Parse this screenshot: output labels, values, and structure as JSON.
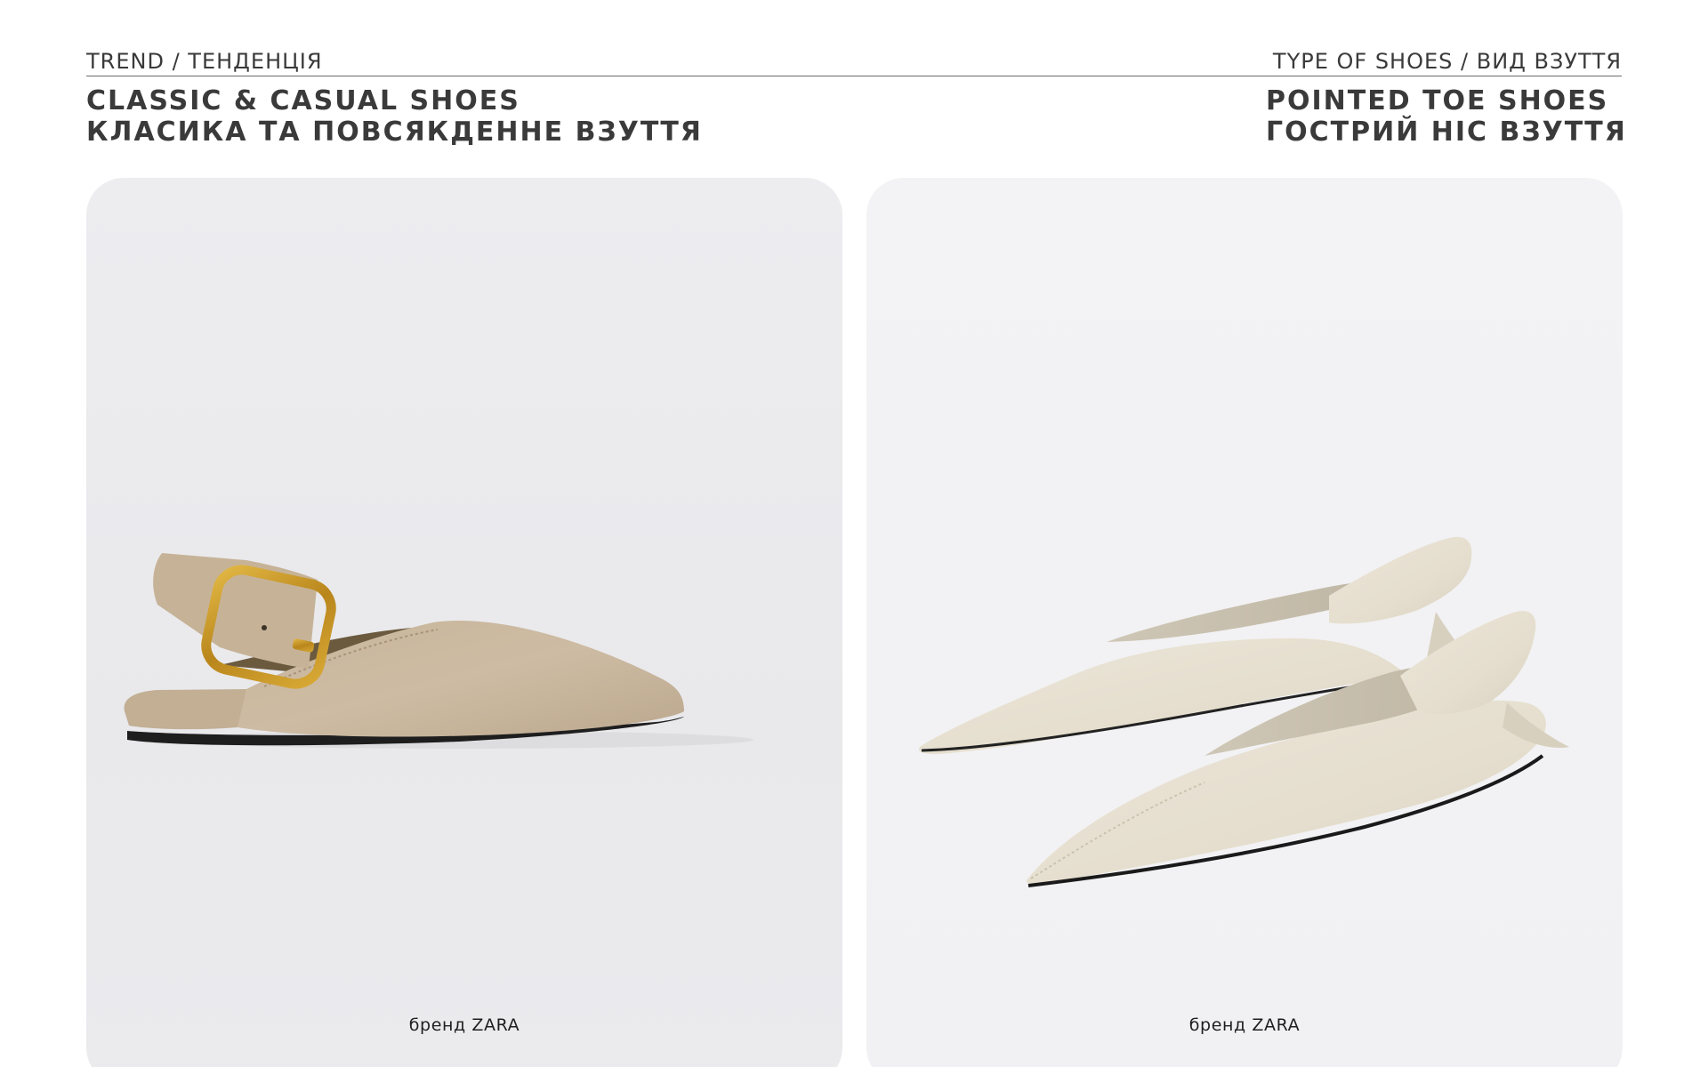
{
  "header": {
    "trend_label": "TREND / ТЕНДЕНЦІЯ",
    "type_label": "TYPE OF SHOES / ВИД ВЗУТТЯ",
    "trend_title_en": "CLASSIC & CASUAL SHOES",
    "trend_title_ua": "КЛАСИКА ТА ПОВСЯКДЕННЕ ВЗУТТЯ",
    "type_title_en": "POINTED TOE SHOES",
    "type_title_ua": "ГОСТРИЙ НІС ВЗУТТЯ"
  },
  "products": [
    {
      "brand_label": "бренд ZARA",
      "color": "#cbb9a0",
      "icon": "suede-slingback-flat-with-gold-buckle"
    },
    {
      "brand_label": "бренд ZARA",
      "color": "#e7e0d2",
      "icon": "cream-leather-slingback-flats-pair"
    }
  ],
  "colors": {
    "background": "#ffffff",
    "text": "#3a3a3a",
    "divider": "#6a6a6a"
  }
}
